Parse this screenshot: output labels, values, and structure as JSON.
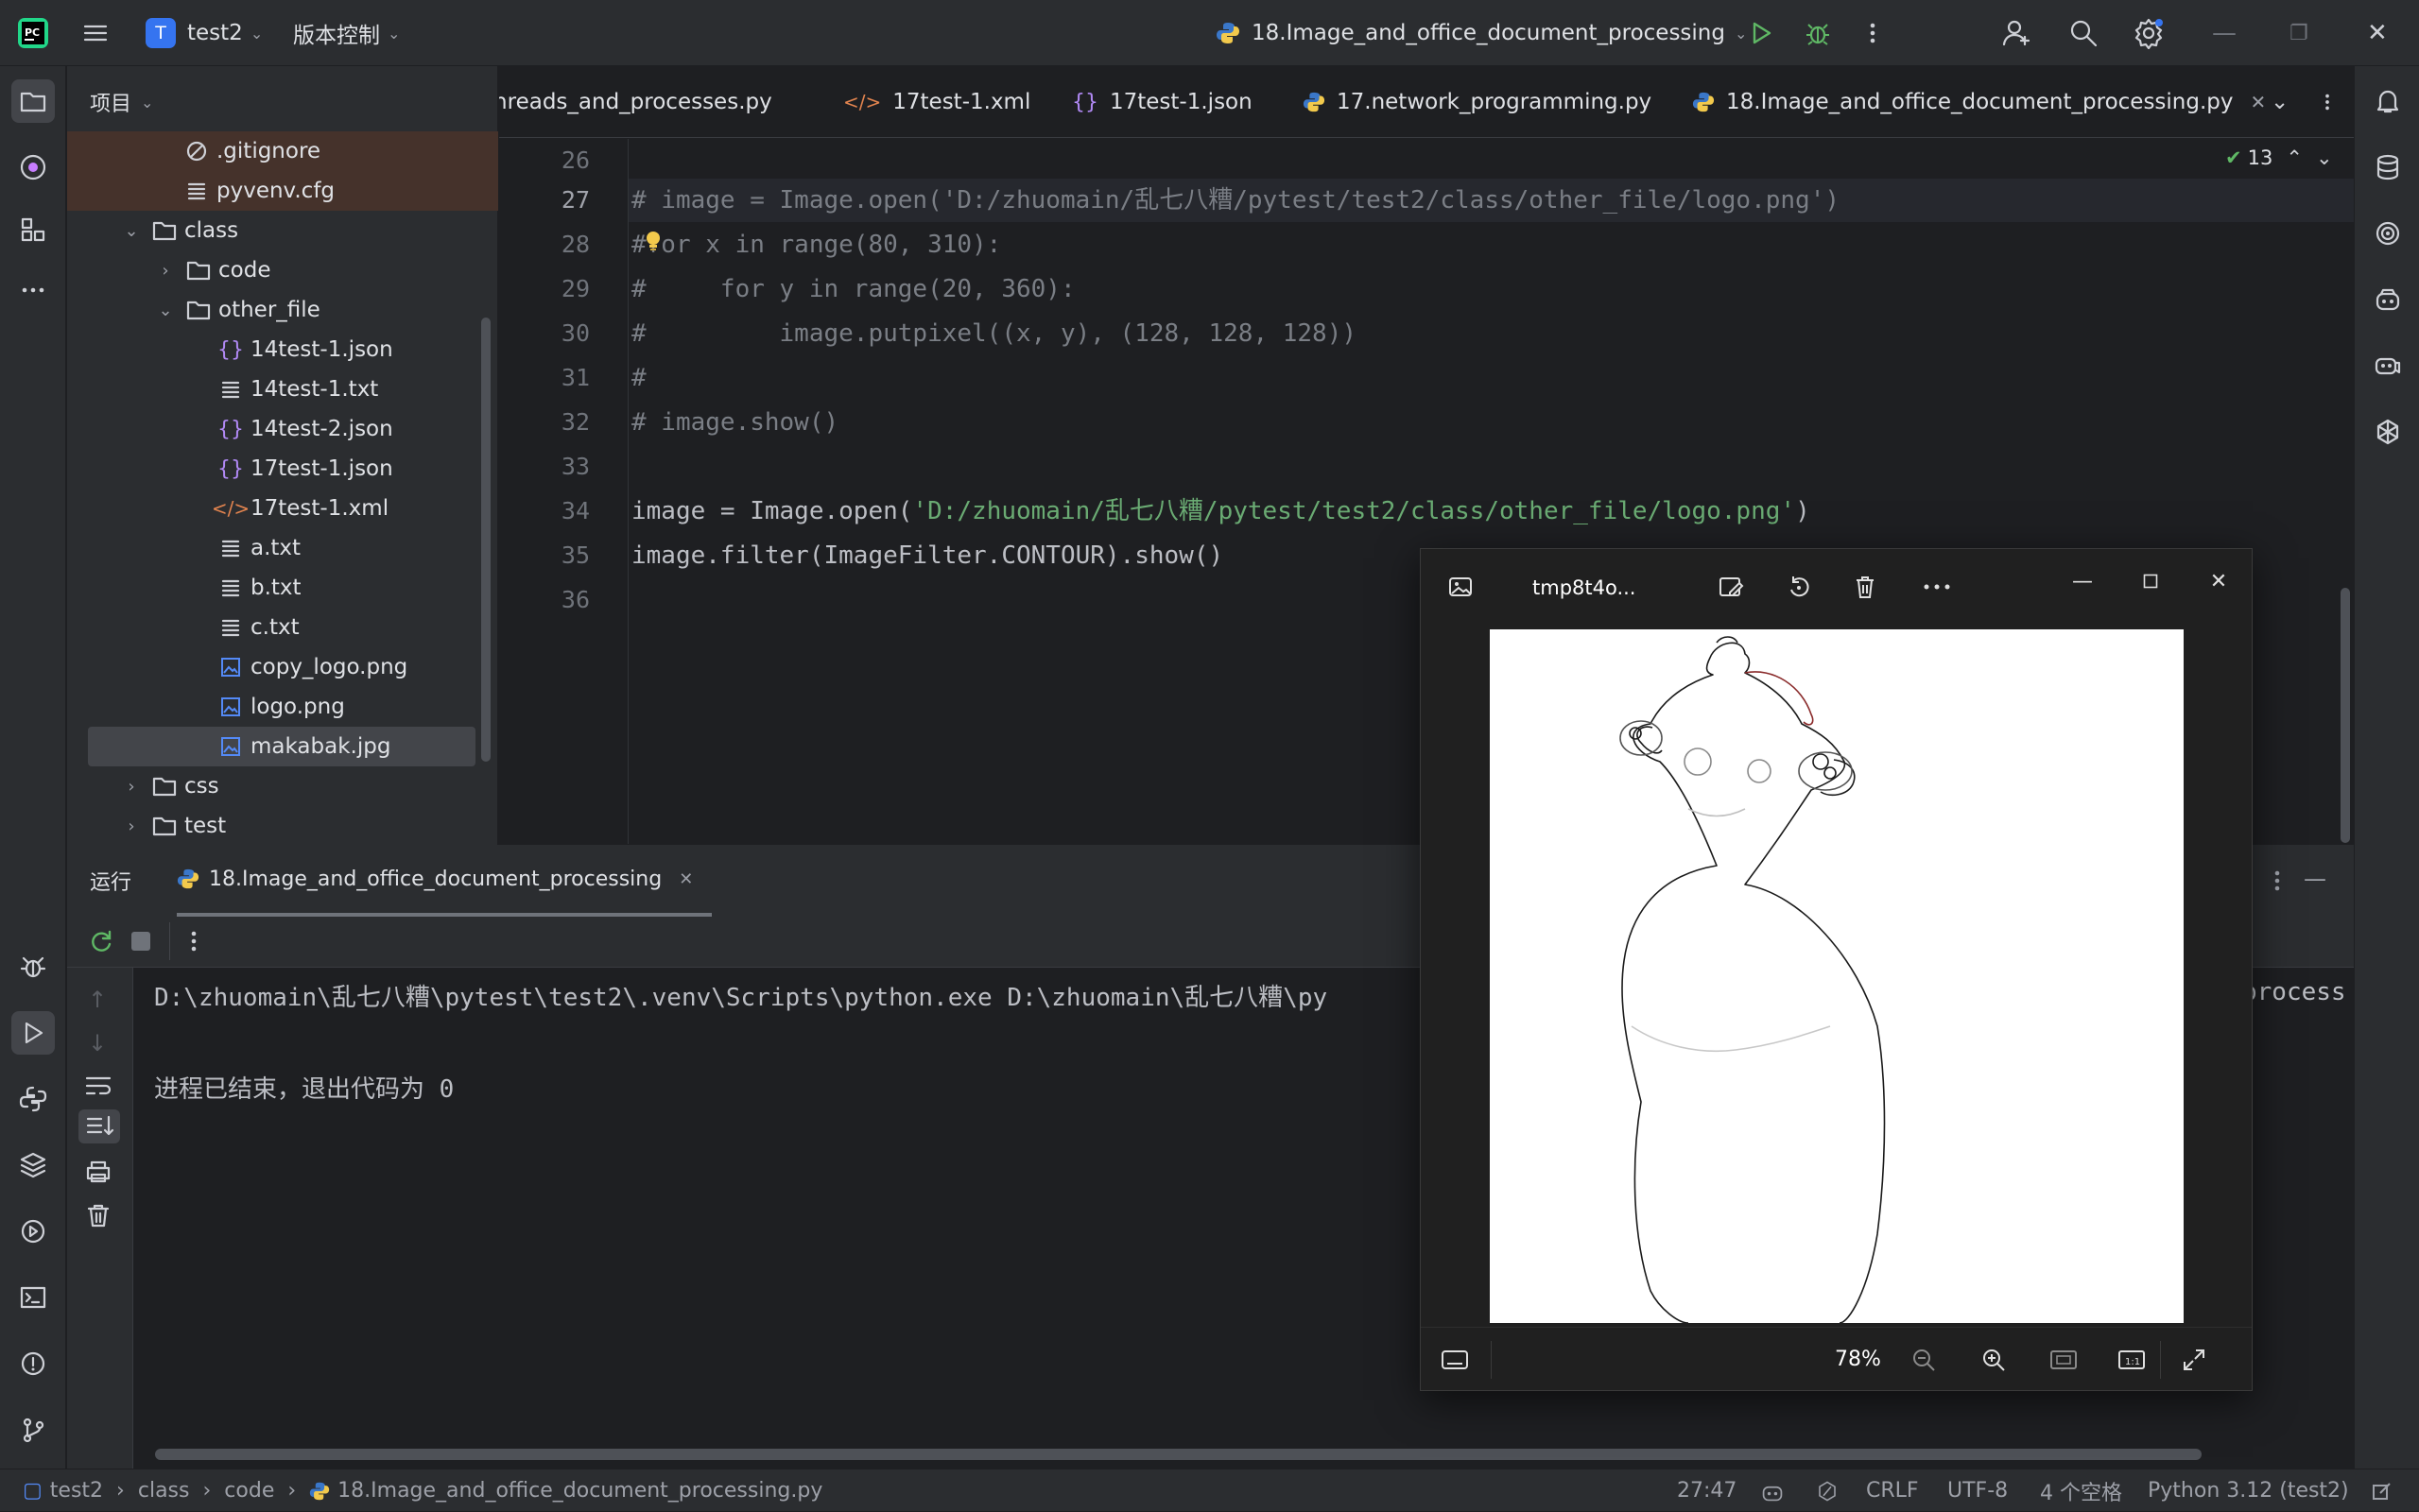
{
  "titlebar": {
    "project_initial": "T",
    "project_name": "test2",
    "vcs_label": "版本控制",
    "run_config": "18.Image_and_office_document_processing"
  },
  "project_panel": {
    "title": "项目",
    "items": [
      {
        "label": ".gitignore",
        "icon": "ignore-icon"
      },
      {
        "label": "pyvenv.cfg",
        "icon": "text-file-icon"
      },
      {
        "label": "class",
        "icon": "folder-icon",
        "expanded": true
      },
      {
        "label": "code",
        "icon": "folder-icon",
        "expanded": false
      },
      {
        "label": "other_file",
        "icon": "folder-icon",
        "expanded": true
      },
      {
        "label": "14test-1.json",
        "icon": "json-file-icon"
      },
      {
        "label": "14test-1.txt",
        "icon": "text-file-icon"
      },
      {
        "label": "14test-2.json",
        "icon": "json-file-icon"
      },
      {
        "label": "17test-1.json",
        "icon": "json-file-icon"
      },
      {
        "label": "17test-1.xml",
        "icon": "xml-file-icon"
      },
      {
        "label": "a.txt",
        "icon": "text-file-icon"
      },
      {
        "label": "b.txt",
        "icon": "text-file-icon"
      },
      {
        "label": "c.txt",
        "icon": "text-file-icon"
      },
      {
        "label": "copy_logo.png",
        "icon": "image-file-icon"
      },
      {
        "label": "logo.png",
        "icon": "image-file-icon"
      },
      {
        "label": "makabak.jpg",
        "icon": "image-file-icon",
        "selected": true
      },
      {
        "label": "css",
        "icon": "folder-icon",
        "expanded": false
      },
      {
        "label": "test",
        "icon": "folder-icon",
        "expanded": false
      }
    ]
  },
  "tabs": [
    {
      "label": "Threads_and_processes.py",
      "icon": "python-icon"
    },
    {
      "label": "17test-1.xml",
      "icon": "xml-file-icon"
    },
    {
      "label": "17test-1.json",
      "icon": "json-file-icon"
    },
    {
      "label": "17.network_programming.py",
      "icon": "python-icon"
    },
    {
      "label": "18.Image_and_office_document_processing.py",
      "icon": "python-icon",
      "active": true
    }
  ],
  "editor": {
    "inspection_count": "13",
    "current_line": "27",
    "lines": [
      {
        "num": "26",
        "text": ""
      },
      {
        "num": "27",
        "text": "# image = Image.open('D:/zhuomain/乱七八糟/pytest/test2/class/other_file/logo.png')"
      },
      {
        "num": "28",
        "text": "#for x in range(80, 310):"
      },
      {
        "num": "29",
        "text": "#     for y in range(20, 360):"
      },
      {
        "num": "30",
        "text": "#         image.putpixel((x, y), (128, 128, 128))"
      },
      {
        "num": "31",
        "text": "#"
      },
      {
        "num": "32",
        "text": "# image.show()"
      },
      {
        "num": "33",
        "text": ""
      },
      {
        "num": "34",
        "prefix": "image = Image.open(",
        "string": "'D:/zhuomain/乱七八糟/pytest/test2/class/other_file/logo.png'",
        "suffix": ")"
      },
      {
        "num": "35",
        "text": "image.filter(ImageFilter.CONTOUR).show()"
      },
      {
        "num": "36",
        "text": ""
      }
    ]
  },
  "run_panel": {
    "title": "运行",
    "tab_label": "18.Image_and_office_document_processing",
    "console_line1": "D:\\zhuomain\\乱七八糟\\pytest\\test2\\.venv\\Scripts\\python.exe D:\\zhuomain\\乱七八糟\\py",
    "console_line1_tail": "process",
    "console_line2": "进程已结束，退出代码为 0"
  },
  "viewer": {
    "title": "tmp8t4o...",
    "zoom": "78%"
  },
  "statusbar": {
    "breadcrumb": [
      "test2",
      "class",
      "code",
      "18.Image_and_office_document_processing.py"
    ],
    "position": "27:47",
    "line_ending": "CRLF",
    "encoding": "UTF-8",
    "indent": "4 个空格",
    "interpreter": "Python 3.12 (test2)"
  }
}
